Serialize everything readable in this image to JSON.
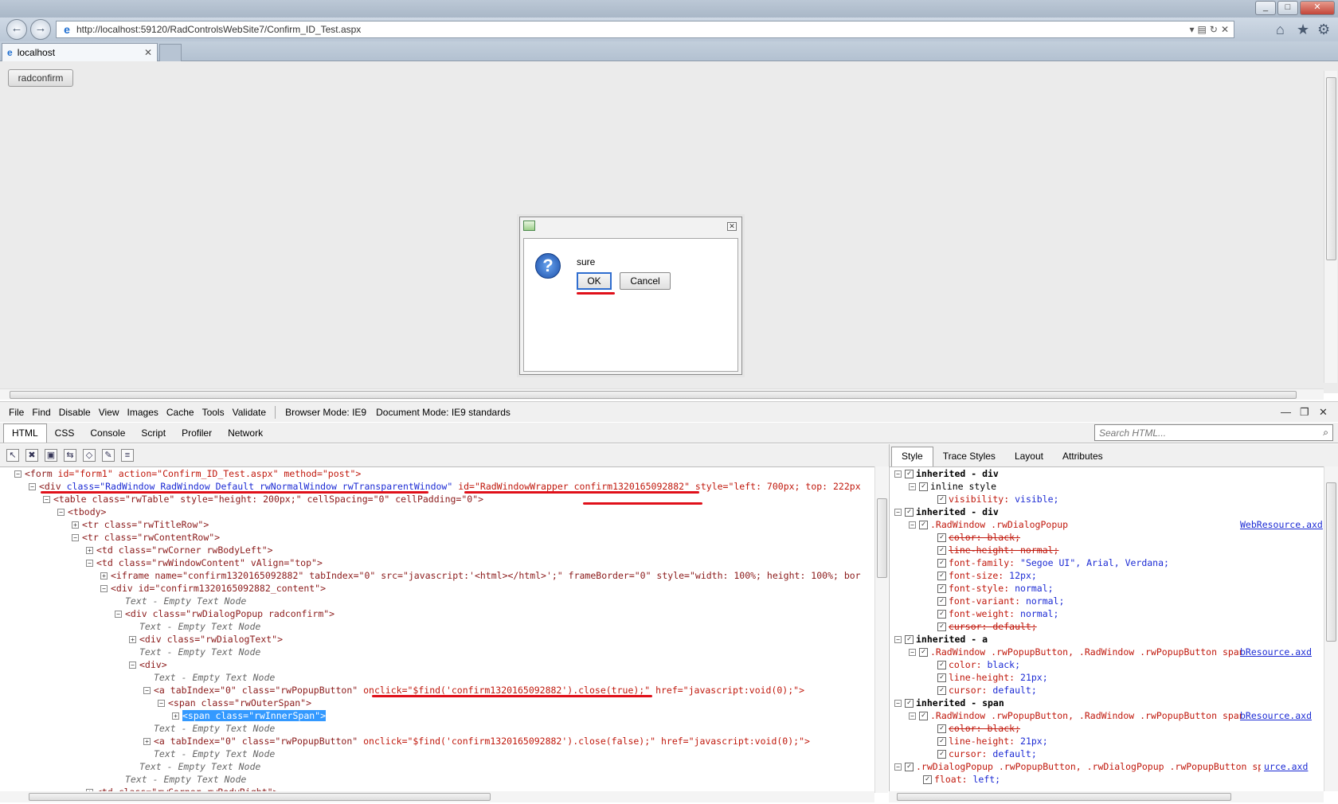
{
  "browser": {
    "url": "http://localhost:59120/RadControlsWebSite7/Confirm_ID_Test.aspx",
    "tab_title": "localhost"
  },
  "page": {
    "button_label": "radconfirm",
    "dialog": {
      "message": "sure",
      "ok_label": "OK",
      "cancel_label": "Cancel"
    }
  },
  "devtools": {
    "menu": [
      "File",
      "Find",
      "Disable",
      "View",
      "Images",
      "Cache",
      "Tools",
      "Validate"
    ],
    "browser_mode": "Browser Mode: IE9",
    "document_mode": "Document Mode: IE9 standards",
    "tabs": [
      "HTML",
      "CSS",
      "Console",
      "Script",
      "Profiler",
      "Network"
    ],
    "search_placeholder": "Search HTML...",
    "side_tabs": [
      "Style",
      "Trace Styles",
      "Layout",
      "Attributes"
    ],
    "tree": {
      "form_tag": "<form",
      "form_attrs": " id=\"form1\" action=\"Confirm_ID_Test.aspx\" method=\"post\">",
      "div_tag": "<div",
      "div_class": " class=\"RadWindow RadWindow_Default rwNormalWindow rwTransparentWindow\"",
      "div_id": " id=\"RadWindowWrapper_confirm1320165092882\"",
      "div_style": " style=\"left: 700px; top: 222px",
      "table_line": "<table class=\"rwTable\" style=\"height: 200px;\" cellSpacing=\"0\" cellPadding=\"0\">",
      "tbody": "<tbody>",
      "tr_title": "<tr class=\"rwTitleRow\">",
      "tr_content": "<tr class=\"rwContentRow\">",
      "td_corner": "<td class=\"rwCorner rwBodyLeft\">",
      "td_content": "<td class=\"rwWindowContent\" vAlign=\"top\">",
      "iframe": "<iframe name=\"confirm1320165092882\" tabIndex=\"0\" src=\"javascript:'<html></html>';\" frameBorder=\"0\" style=\"width: 100%; height: 100%; bor",
      "div_content": "<div id=\"confirm1320165092882_content\">",
      "empty_text": "Text - Empty Text Node",
      "div_popup": "<div class=\"rwDialogPopup radconfirm\">",
      "div_text": "<div class=\"rwDialogText\">",
      "div_plain": "<div>",
      "a1_start": "<a tabIndex=\"0\" class=\"rwPopupButton\"",
      "a1_onclick": " onclick=\"$find('confirm1320165092882').close(true);\"",
      "a_href": " href=\"javascript:void(0);\">",
      "span_outer": "<span class=\"rwOuterSpan\">",
      "span_inner": "<span class=\"rwInnerSpan\">",
      "a2_start": "<a tabIndex=\"0\" class=\"rwPopupButton\"",
      "a2_onclick": " onclick=\"$find('confirm1320165092882').close(false);\"",
      "last_line": "<td class=\"rwCorner rwBodyRight\">"
    },
    "styles": {
      "inherited_div": "inherited - div",
      "inline_style": "inline style",
      "visibility": "visibility:",
      "visibility_val": " visible;",
      "rule1": ".RadWindow .rwDialogPopup",
      "rule1_src": "WebResource.axd",
      "color_black": "color: black;",
      "lh_normal": "line-height: normal;",
      "font_family": "font-family:",
      "font_family_val": " \"Segoe UI\", Arial, Verdana;",
      "font_size": "font-size:",
      "font_size_val": " 12px;",
      "font_style": "font-style:",
      "font_style_val": " normal;",
      "font_variant": "font-variant:",
      "font_variant_val": " normal;",
      "font_weight": "font-weight:",
      "font_weight_val": " normal;",
      "cursor_default": "cursor: default;",
      "inherited_a": "inherited - a",
      "rule2": ".RadWindow .rwPopupButton, .RadWindow .rwPopupButton span",
      "rule2_src": "bResource.axd",
      "color": "color:",
      "color_val": " black;",
      "line_height": "line-height:",
      "line_height_val": " 21px;",
      "cursor": "cursor:",
      "cursor_val": " default;",
      "inherited_span": "inherited - span",
      "rule4": ".rwDialogPopup .rwPopupButton, .rwDialogPopup .rwPopupButton span",
      "rule4_src": "urce.axd",
      "float": "float:",
      "float_val": " left;"
    }
  }
}
